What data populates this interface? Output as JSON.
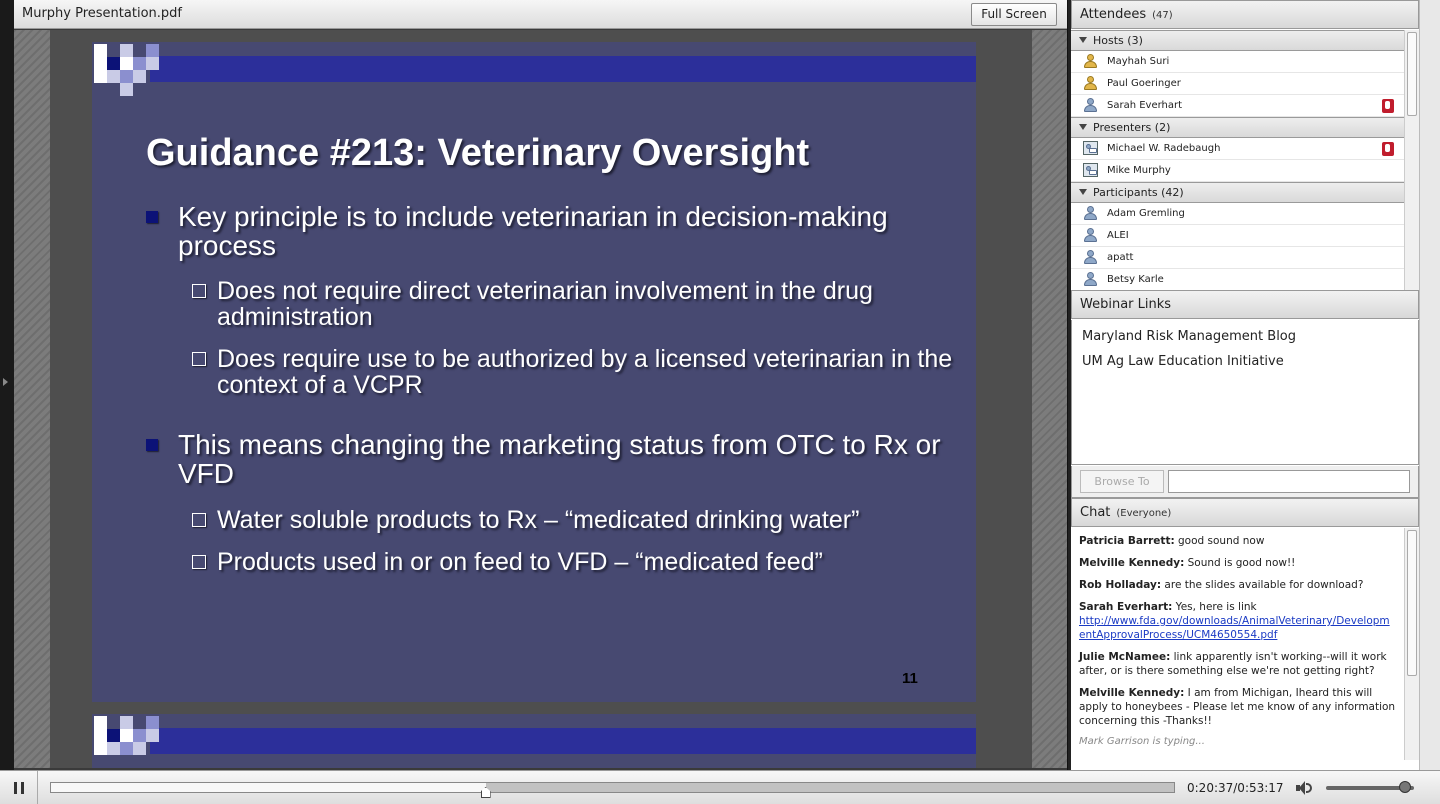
{
  "document": {
    "title": "Murphy Presentation.pdf",
    "fullscreen_label": "Full Screen"
  },
  "slide": {
    "title": "Guidance #213:  Veterinary Oversight",
    "bullets": [
      {
        "text": "Key principle is to include veterinarian in decision-making process"
      },
      {
        "text": "Does not require direct veterinarian involvement in the drug administration"
      },
      {
        "text": "Does require use to be authorized by a licensed veterinarian in the context of a VCPR"
      },
      {
        "text": "This means changing the marketing status from OTC to Rx or VFD"
      },
      {
        "text": "Water soluble products to Rx – “medicated drinking water”"
      },
      {
        "text": "Products used in or on feed to VFD – “medicated feed”"
      }
    ],
    "number": "11"
  },
  "attendees": {
    "title": "Attendees",
    "count": "(47)",
    "groups": {
      "hosts": {
        "label": "Hosts (3)",
        "members": [
          "Mayhah Suri",
          "Paul Goeringer",
          "Sarah Everhart"
        ]
      },
      "presenters": {
        "label": "Presenters (2)",
        "members": [
          "Michael W. Radebaugh",
          "Mike Murphy"
        ]
      },
      "participants": {
        "label": "Participants (42)",
        "members": [
          "Adam Gremling",
          "ALEI",
          "apatt",
          "Betsy Karle"
        ]
      }
    }
  },
  "links": {
    "title": "Webinar Links",
    "items": [
      "Maryland Risk Management Blog",
      "UM Ag Law Education Initiative"
    ],
    "browse_label": "Browse To",
    "url_value": ""
  },
  "chat": {
    "title": "Chat",
    "scope": "(Everyone)",
    "messages": [
      {
        "author": "Patricia Barrett:",
        "text": "good sound now"
      },
      {
        "author": "Melville Kennedy:",
        "text": "Sound is good now!!"
      },
      {
        "author": "Rob Holladay:",
        "text": "are the slides available for download?"
      },
      {
        "author": "Sarah Everhart:",
        "text": "Yes, here is link",
        "link": "http://www.fda.gov/downloads/AnimalVeterinary/DevelopmentApprovalProcess/UCM4650554.pdf"
      },
      {
        "author": "Julie McNamee:",
        "text": "link apparently isn't working--will it work after, or is there something else we're not getting right?"
      },
      {
        "author": "Melville Kennedy:",
        "text": "I am from Michigan, Iheard this will apply to honeybees - Please let me know of any information concerning this -Thanks!!"
      }
    ],
    "typing": "Mark Garrison is typing..."
  },
  "player": {
    "time": "0:20:37/0:53:17",
    "progress": 0.387,
    "volume": 0.9
  }
}
